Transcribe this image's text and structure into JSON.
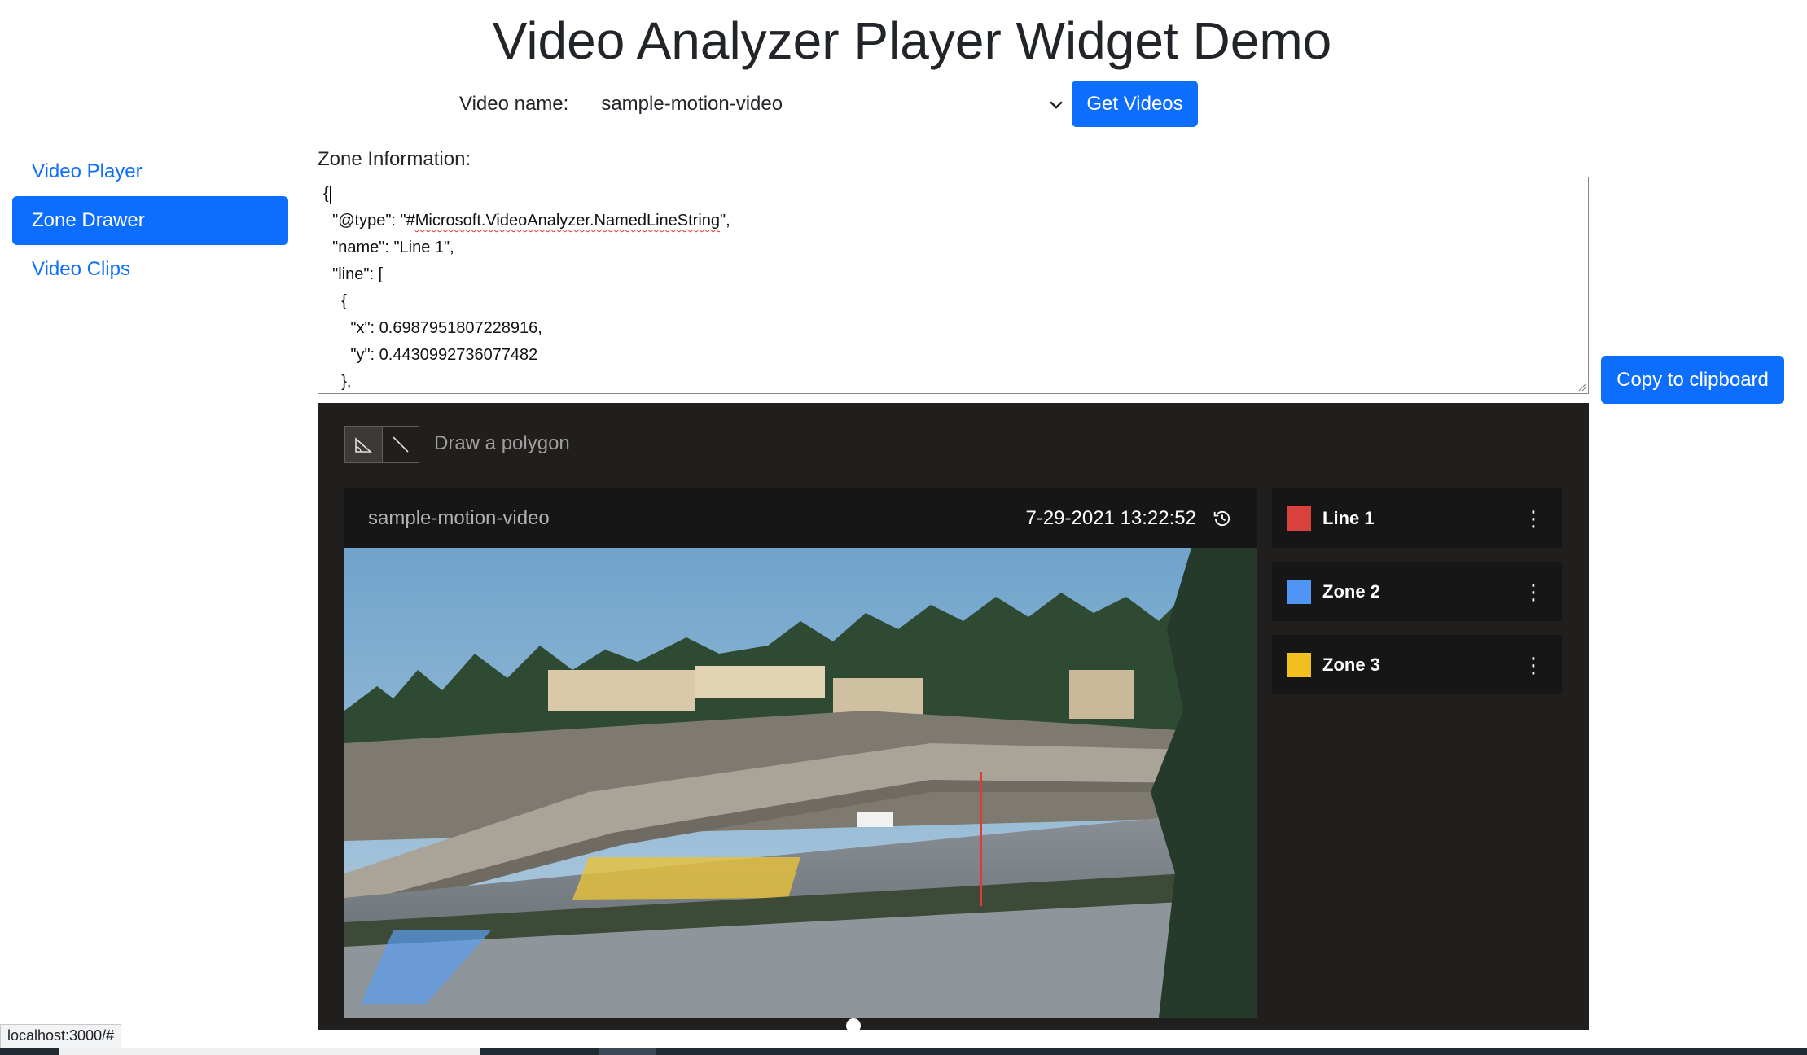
{
  "page": {
    "title": "Video Analyzer Player Widget Demo"
  },
  "video_selector": {
    "label": "Video name:",
    "selected_value": "sample-motion-video",
    "button_label": "Get Videos"
  },
  "nav": {
    "items": [
      {
        "label": "Video Player",
        "active": false
      },
      {
        "label": "Zone Drawer",
        "active": true
      },
      {
        "label": "Video Clips",
        "active": false
      }
    ]
  },
  "zone_info": {
    "label": "Zone Information:",
    "lines": [
      "{",
      "  \"@type\": \"#",
      "  \"name\": \"Line 1\",",
      "  \"line\": [",
      "    {",
      "      \"x\": 0.6987951807228916,",
      "      \"y\": 0.4430992736077482",
      "    },"
    ],
    "type_value_misspelled": "Microsoft.VideoAnalyzer.NamedLineString",
    "type_value_suffix": "\",",
    "copy_button_label": "Copy to clipboard"
  },
  "widget": {
    "draw_hint": "Draw a polygon",
    "player": {
      "title": "sample-motion-video",
      "timestamp": "7-29-2021 13:22:52",
      "playback_position": 0.55
    },
    "zones": [
      {
        "name": "Line 1",
        "color": "#d9423c"
      },
      {
        "name": "Zone 2",
        "color": "#4f95f5"
      },
      {
        "name": "Zone 3",
        "color": "#f2c01e"
      }
    ]
  },
  "status_bar": {
    "url": "localhost:3000/#"
  },
  "colors": {
    "primary": "#0d6efd",
    "widget_bg": "#201f1e"
  },
  "icons": [
    "chevron-down-icon",
    "polygon-tool-icon",
    "line-tool-icon",
    "history-icon",
    "more-vertical-icon",
    "resize-grip-icon"
  ]
}
